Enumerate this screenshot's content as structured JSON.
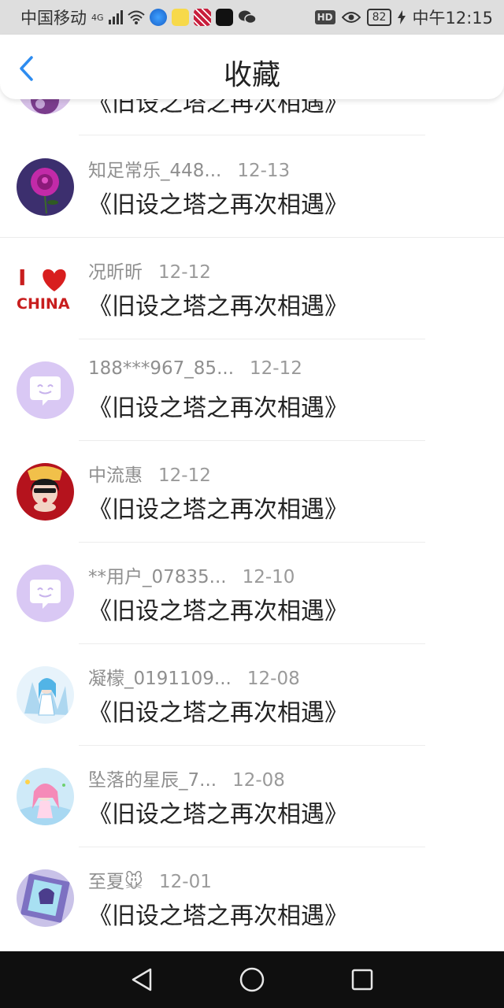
{
  "status_bar": {
    "carrier": "中国移动",
    "signal": "4G",
    "hd": "HD",
    "battery": "82",
    "time": "中午12:15"
  },
  "header": {
    "title": "收藏"
  },
  "partial_item": {
    "book": "《旧设之塔之再次相遇》"
  },
  "items": [
    {
      "user": "知足常乐_448...",
      "date": "12-13",
      "book": "《旧设之塔之再次相遇》",
      "avatar": "rose"
    },
    {
      "user": "况昕昕",
      "date": "12-12",
      "book": "《旧设之塔之再次相遇》",
      "avatar": "i-love-china"
    },
    {
      "user": "188***967_85...",
      "date": "12-12",
      "book": "《旧设之塔之再次相遇》",
      "avatar": "default-chat"
    },
    {
      "user": "中流惠",
      "date": "12-12",
      "book": "《旧设之塔之再次相遇》",
      "avatar": "girl-red"
    },
    {
      "user": "**用户_07835...",
      "date": "12-10",
      "book": "《旧设之塔之再次相遇》",
      "avatar": "default-chat"
    },
    {
      "user": "凝檬_0191109...",
      "date": "12-08",
      "book": "《旧设之塔之再次相遇》",
      "avatar": "anime-blue"
    },
    {
      "user": "坠落的星辰_7...",
      "date": "12-08",
      "book": "《旧设之塔之再次相遇》",
      "avatar": "anime-pink"
    },
    {
      "user": "至夏🐭",
      "date": "12-01",
      "book": "《旧设之塔之再次相遇》",
      "avatar": "anime-purple"
    }
  ],
  "avatar_i_love_china": {
    "top": "I",
    "bottom": "CHINA"
  },
  "colors": {
    "accent_blue": "#2d8cf0",
    "default_avatar_bg": "#d9c8f4",
    "username_gray": "#8f8f8f"
  }
}
